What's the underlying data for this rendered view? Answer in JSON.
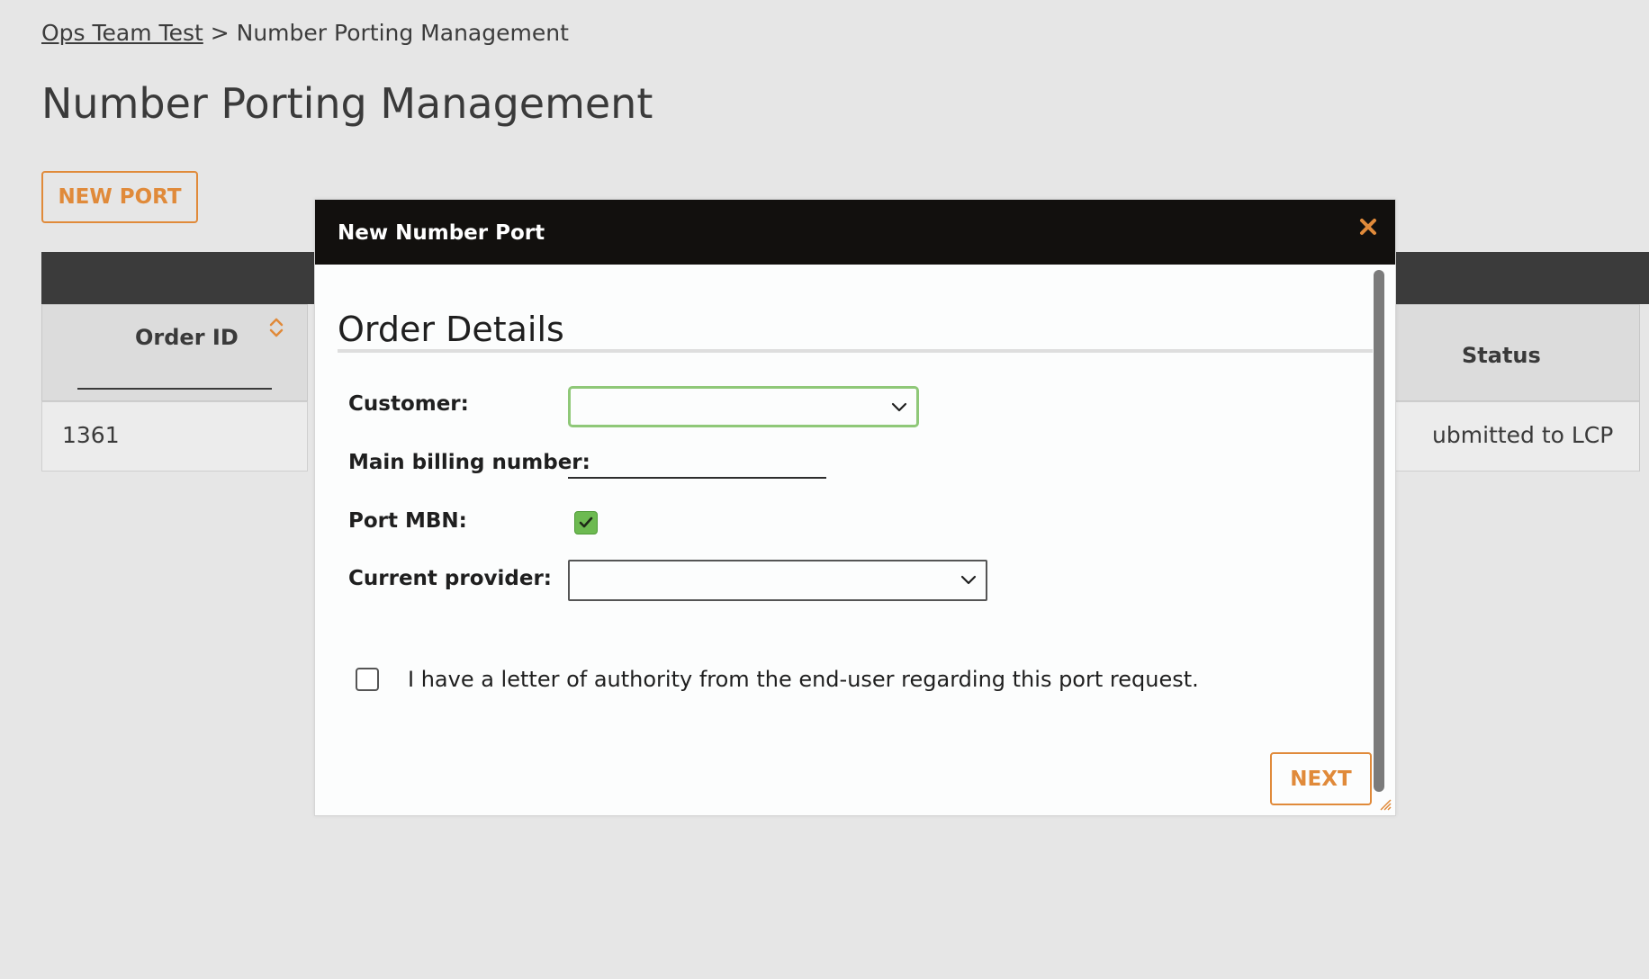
{
  "breadcrumb": {
    "parent": "Ops Team Test",
    "separator": ">",
    "current": "Number Porting Management"
  },
  "page": {
    "title": "Number Porting Management"
  },
  "toolbar": {
    "new_port_label": "NEW PORT"
  },
  "table": {
    "columns": {
      "order_id": "Order ID",
      "status": "Status"
    },
    "rows": [
      {
        "order_id": "1361",
        "status": "ubmitted to LCP"
      }
    ]
  },
  "modal": {
    "title": "New Number Port",
    "section_title": "Order Details",
    "fields": {
      "customer_label": "Customer:",
      "customer_value": "",
      "mbn_label": "Main billing number:",
      "mbn_value": "",
      "port_mbn_label": "Port MBN:",
      "port_mbn_checked": true,
      "provider_label": "Current provider:",
      "provider_value": ""
    },
    "loa_text": "I have a letter of authority from the end-user regarding this port request.",
    "loa_checked": false,
    "next_label": "NEXT"
  },
  "colors": {
    "accent": "#e08a3a",
    "header_dark": "#12100e",
    "table_header": "#3b3b3b",
    "focus_border": "#8fc878",
    "checkbox_green": "#6dba51",
    "page_bg": "#e6e6e6"
  },
  "icons": {
    "close": "close-icon",
    "sort": "sort-icon",
    "chevron": "chevron-down-icon",
    "check": "checkmark-icon",
    "resize": "resize-grip-icon"
  }
}
